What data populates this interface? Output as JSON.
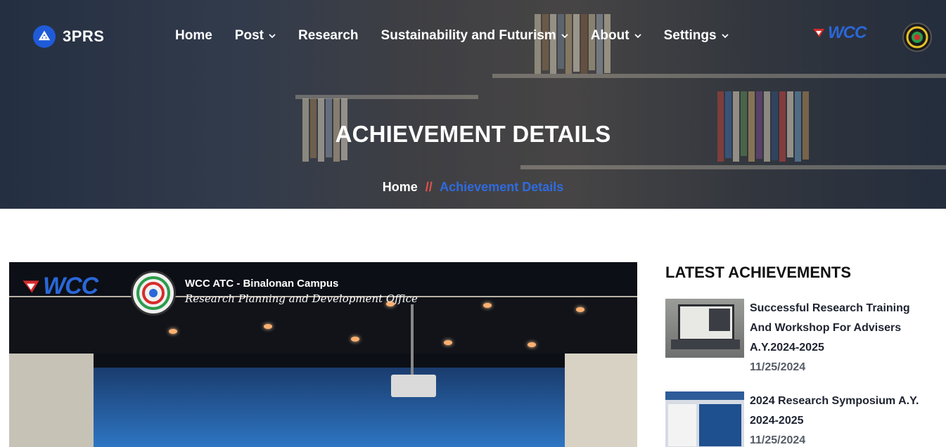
{
  "brand": {
    "name": "3PRS"
  },
  "nav": {
    "items": [
      {
        "label": "Home",
        "dropdown": false
      },
      {
        "label": "Post",
        "dropdown": true
      },
      {
        "label": "Research",
        "dropdown": false
      },
      {
        "label": "Sustainability and Futurism",
        "dropdown": true
      },
      {
        "label": "About",
        "dropdown": true
      },
      {
        "label": "Settings",
        "dropdown": true
      }
    ]
  },
  "header_logos": {
    "wcc": "WCC"
  },
  "hero": {
    "title": "ACHIEVEMENT DETAILS",
    "breadcrumb": {
      "home": "Home",
      "separator": "//",
      "current": "Achievement Details"
    }
  },
  "feature_image": {
    "logo_text": "WCC",
    "caption_line1": "WCC ATC - Binalonan Campus",
    "caption_line2": "Research Planning and Development Office"
  },
  "sidebar": {
    "title": "LATEST ACHIEVEMENTS",
    "posts": [
      {
        "title": "Successful Research Training And Workshop For Advisers A.Y.2024-2025",
        "date": "11/25/2024"
      },
      {
        "title": "2024 Research Symposium A.Y. 2024-2025",
        "date": "11/25/2024"
      }
    ]
  },
  "colors": {
    "accent": "#2f6be0",
    "separator": "#e5534b",
    "brand": "#1f5bd9"
  }
}
